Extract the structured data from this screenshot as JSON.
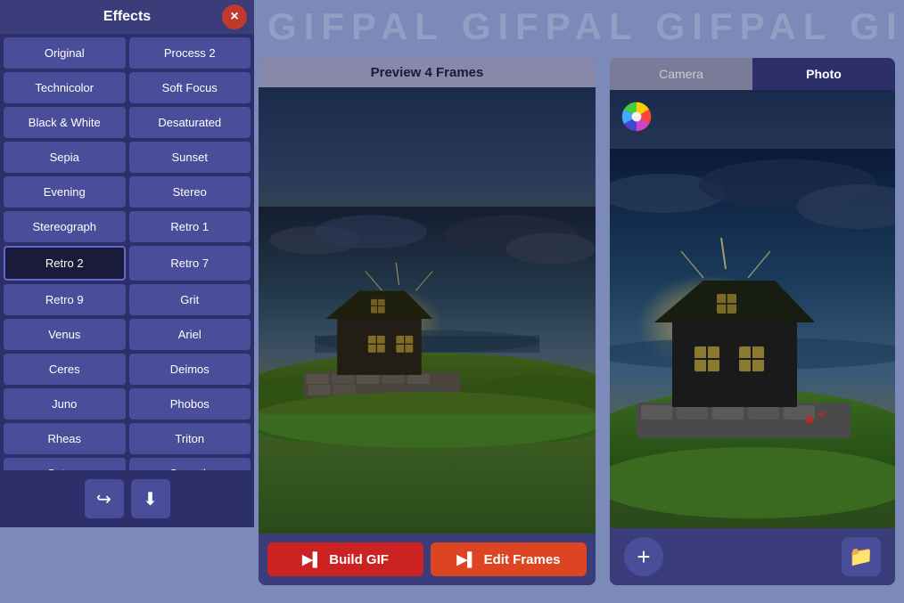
{
  "watermark": {
    "text": "GIFPAL GIFPAL GIFPAL GIFPAL GIFPAL"
  },
  "effects_panel": {
    "title": "Effects",
    "close_label": "×",
    "buttons": [
      {
        "id": "original",
        "label": "Original",
        "active": false
      },
      {
        "id": "process2",
        "label": "Process 2",
        "active": false
      },
      {
        "id": "technicolor",
        "label": "Technicolor",
        "active": false
      },
      {
        "id": "soft-focus",
        "label": "Soft Focus",
        "active": false
      },
      {
        "id": "black-white",
        "label": "Black & White",
        "active": false
      },
      {
        "id": "desaturated",
        "label": "Desaturated",
        "active": false
      },
      {
        "id": "sepia",
        "label": "Sepia",
        "active": false
      },
      {
        "id": "sunset",
        "label": "Sunset",
        "active": false
      },
      {
        "id": "evening",
        "label": "Evening",
        "active": false
      },
      {
        "id": "stereo",
        "label": "Stereo",
        "active": false
      },
      {
        "id": "stereograph",
        "label": "Stereograph",
        "active": false
      },
      {
        "id": "retro1",
        "label": "Retro 1",
        "active": false
      },
      {
        "id": "retro2",
        "label": "Retro 2",
        "active": true
      },
      {
        "id": "retro7",
        "label": "Retro 7",
        "active": false
      },
      {
        "id": "retro9",
        "label": "Retro 9",
        "active": false
      },
      {
        "id": "grit",
        "label": "Grit",
        "active": false
      },
      {
        "id": "venus",
        "label": "Venus",
        "active": false
      },
      {
        "id": "ariel",
        "label": "Ariel",
        "active": false
      },
      {
        "id": "ceres",
        "label": "Ceres",
        "active": false
      },
      {
        "id": "deimos",
        "label": "Deimos",
        "active": false
      },
      {
        "id": "juno",
        "label": "Juno",
        "active": false
      },
      {
        "id": "phobos",
        "label": "Phobos",
        "active": false
      },
      {
        "id": "rheas",
        "label": "Rheas",
        "active": false
      },
      {
        "id": "triton",
        "label": "Triton",
        "active": false
      },
      {
        "id": "saturn",
        "label": "Saturn",
        "active": false
      },
      {
        "id": "smooth",
        "label": "Smooth",
        "active": false
      }
    ],
    "footer_buttons": [
      {
        "id": "share",
        "icon": "↪",
        "label": "share-button"
      },
      {
        "id": "download",
        "icon": "⬇",
        "label": "download-button"
      }
    ]
  },
  "preview_panel": {
    "header": "Preview 4 Frames",
    "build_gif_label": "Build GIF",
    "edit_frames_label": "Edit Frames"
  },
  "photo_panel": {
    "tabs": [
      {
        "id": "camera",
        "label": "Camera",
        "active": false
      },
      {
        "id": "photo",
        "label": "Photo",
        "active": true
      }
    ],
    "add_label": "+",
    "folder_label": "📁"
  }
}
